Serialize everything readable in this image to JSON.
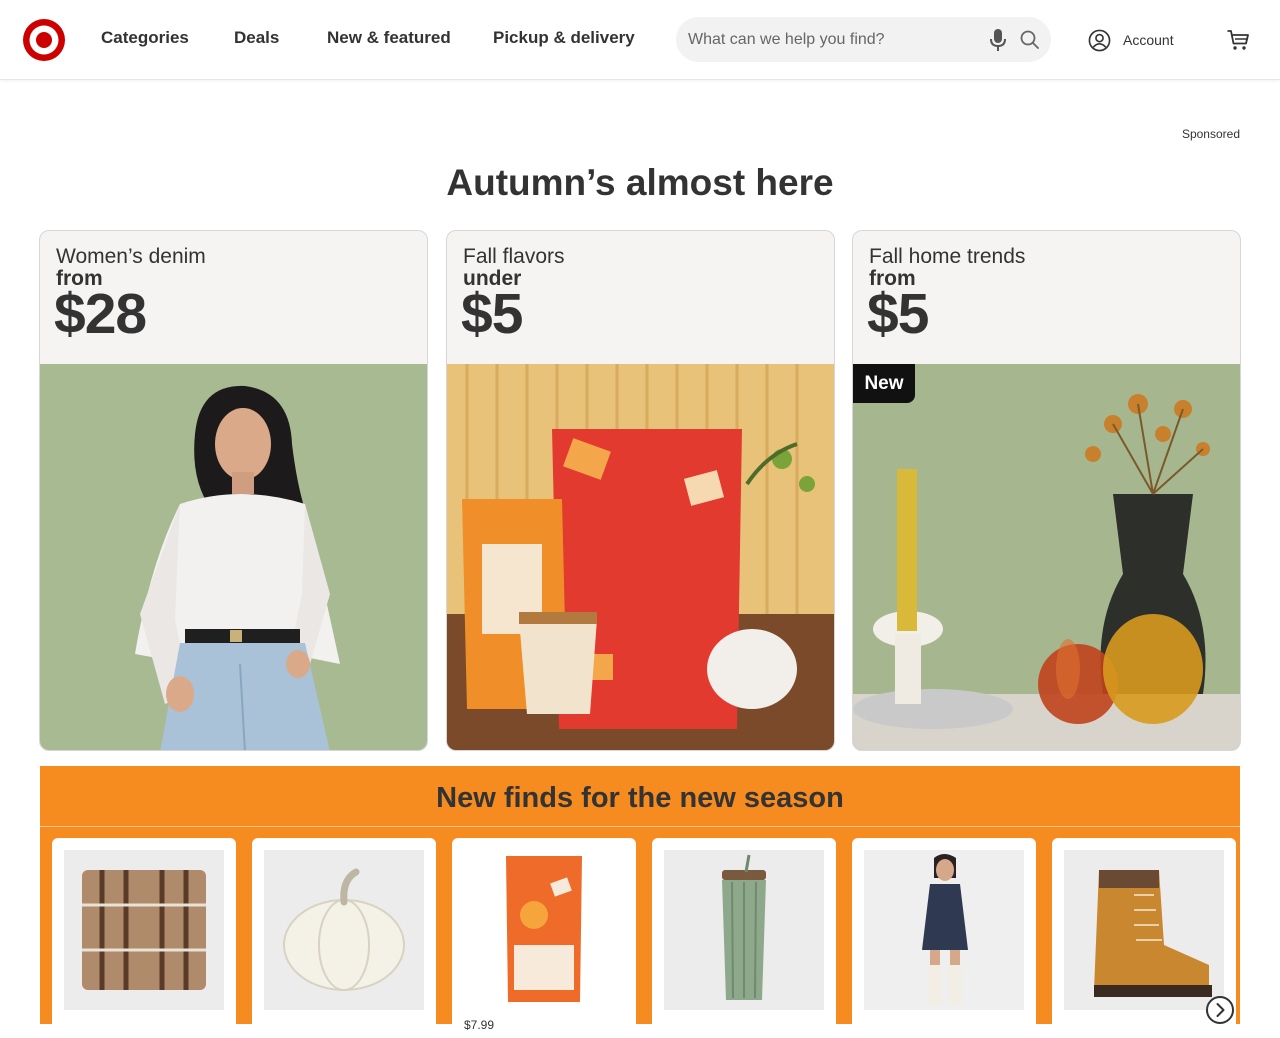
{
  "header": {
    "nav": [
      "Categories",
      "Deals",
      "New & featured",
      "Pickup & delivery"
    ],
    "search_placeholder": "What can we help you find?",
    "account_label": "Account"
  },
  "promo": {
    "sponsored_label": "Sponsored",
    "headline": "Autumn’s almost here",
    "cards": [
      {
        "title": "Women’s denim",
        "qualifier": "from",
        "price": "$28"
      },
      {
        "title": "Fall flavors",
        "qualifier": "under",
        "price": "$5"
      },
      {
        "title": "Fall home trends",
        "qualifier": "from",
        "price": "$5",
        "badge": "New"
      }
    ]
  },
  "new_finds": {
    "title": "New finds for the new season",
    "partial_price": "$7.99",
    "products": [
      "plaid-pillow",
      "glass-pumpkin",
      "pumpkin-spice-coffee",
      "green-tumbler",
      "denim-dress",
      "tan-boots"
    ]
  },
  "colors": {
    "brand_red": "#cc0000",
    "accent_orange": "#f68b1f"
  }
}
